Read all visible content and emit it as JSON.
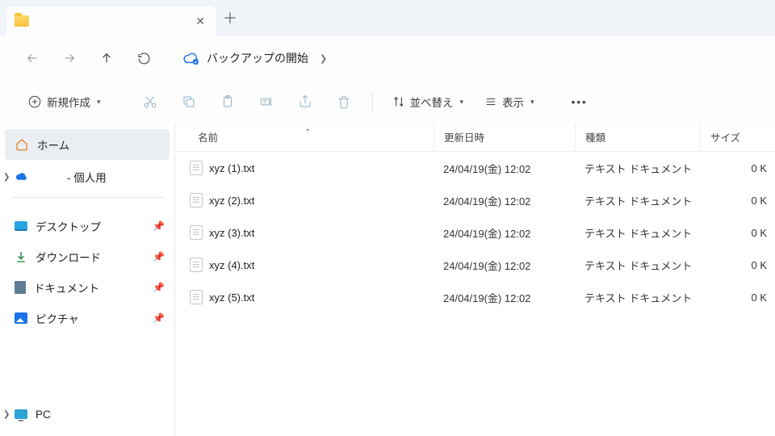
{
  "tab": {
    "title": "",
    "close": "✕",
    "new": "＋"
  },
  "nav": {
    "backup_label": "バックアップの開始",
    "crumb_obscured": "　　　"
  },
  "toolbar": {
    "new_label": "新規作成",
    "sort_label": "並べ替え",
    "view_label": "表示"
  },
  "sidebar": {
    "home": "ホーム",
    "onedrive_suffix": " - 個人用",
    "onedrive_name": "　　",
    "desktop": "デスクトップ",
    "downloads": "ダウンロード",
    "documents": "ドキュメント",
    "pictures": "ピクチャ",
    "pc": "PC"
  },
  "columns": {
    "name": "名前",
    "date": "更新日時",
    "type": "種類",
    "size": "サイズ"
  },
  "files": [
    {
      "name": "xyz (1).txt",
      "date": "24/04/19(金) 12:02",
      "type": "テキスト ドキュメント",
      "size": "0 K"
    },
    {
      "name": "xyz (2).txt",
      "date": "24/04/19(金) 12:02",
      "type": "テキスト ドキュメント",
      "size": "0 K"
    },
    {
      "name": "xyz (3).txt",
      "date": "24/04/19(金) 12:02",
      "type": "テキスト ドキュメント",
      "size": "0 K"
    },
    {
      "name": "xyz (4).txt",
      "date": "24/04/19(金) 12:02",
      "type": "テキスト ドキュメント",
      "size": "0 K"
    },
    {
      "name": "xyz (5).txt",
      "date": "24/04/19(金) 12:02",
      "type": "テキスト ドキュメント",
      "size": "0 K"
    }
  ]
}
